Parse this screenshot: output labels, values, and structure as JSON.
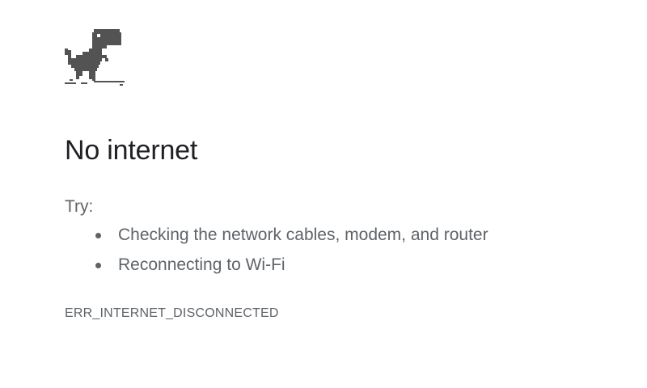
{
  "icon": "offline-dino-icon",
  "heading": "No internet",
  "try_label": "Try:",
  "suggestions": [
    "Checking the network cables, modem, and router",
    "Reconnecting to Wi-Fi"
  ],
  "error_code": "ERR_INTERNET_DISCONNECTED",
  "colors": {
    "background": "#ffffff",
    "heading": "#202124",
    "body_text": "#5f6368",
    "dino": "#535353"
  }
}
